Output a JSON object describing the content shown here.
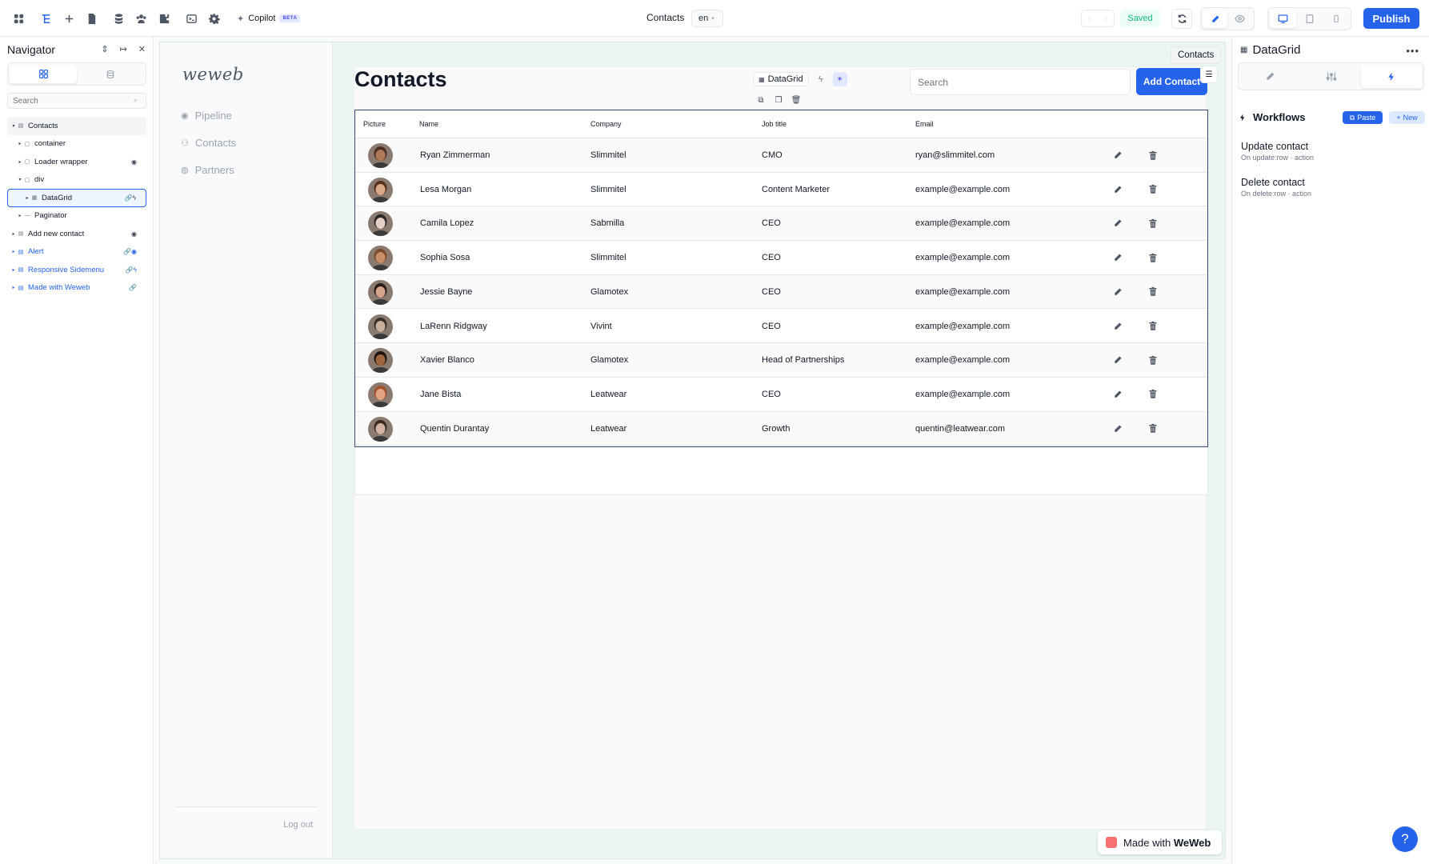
{
  "topbar": {
    "copilot_label": "Copilot",
    "beta_label": "BETA",
    "page_name": "Contacts",
    "language": "en",
    "saved_label": "Saved",
    "publish_label": "Publish"
  },
  "navigator": {
    "title": "Navigator",
    "search_placeholder": "Search",
    "items": [
      {
        "label": "Contacts",
        "depth": 0,
        "icon": "section",
        "badge": ""
      },
      {
        "label": "container",
        "depth": 1,
        "icon": "box",
        "badge": ""
      },
      {
        "label": "Loader wrapper",
        "depth": 1,
        "icon": "box",
        "badge": "hidden"
      },
      {
        "label": "div",
        "depth": 1,
        "icon": "box",
        "badge": ""
      },
      {
        "label": "DataGrid",
        "depth": 2,
        "icon": "grid",
        "badge": "link-bolt"
      },
      {
        "label": "Paginator",
        "depth": 1,
        "icon": "dash",
        "badge": ""
      },
      {
        "label": "Add new contact",
        "depth": 0,
        "icon": "section",
        "badge": "hidden"
      },
      {
        "label": "Alert",
        "depth": 0,
        "icon": "section",
        "badge": "link-hidden"
      },
      {
        "label": "Responsive Sidemenu",
        "depth": 0,
        "icon": "section",
        "badge": "link-bolt"
      },
      {
        "label": "Made with Weweb",
        "depth": 0,
        "icon": "section",
        "badge": "link"
      }
    ]
  },
  "app": {
    "logo": "weweb",
    "menu": [
      "Pipeline",
      "Contacts",
      "Partners"
    ],
    "logout": "Log out",
    "title": "Contacts",
    "datagrid_chip": "DataGrid",
    "search_placeholder": "Search",
    "add_contact": "Add Contact",
    "contacts_tag": "Contacts",
    "made_with": "Made with",
    "made_with_brand": "WeWeb",
    "help": "?"
  },
  "grid": {
    "columns": [
      "Picture",
      "Name",
      "Company",
      "Job title",
      "Email"
    ],
    "rows": [
      {
        "name": "Ryan Zimmerman",
        "company": "Slimmitel",
        "job": "CMO",
        "email": "ryan@slimmitel.com",
        "skin": "#b07a5a",
        "hair": "#4a3020"
      },
      {
        "name": "Lesa Morgan",
        "company": "Slimmitel",
        "job": "Content Marketer",
        "email": "example@example.com",
        "skin": "#d9a98a",
        "hair": "#5a2f20"
      },
      {
        "name": "Camila Lopez",
        "company": "Sabmilla",
        "job": "CEO",
        "email": "example@example.com",
        "skin": "#e6d0c4",
        "hair": "#2a2a2a"
      },
      {
        "name": "Sophia Sosa",
        "company": "Slimmitel",
        "job": "CEO",
        "email": "example@example.com",
        "skin": "#c98e6a",
        "hair": "#7a4a2a"
      },
      {
        "name": "Jessie Bayne",
        "company": "Glamotex",
        "job": "CEO",
        "email": "example@example.com",
        "skin": "#d6a48c",
        "hair": "#2a1a18"
      },
      {
        "name": "LaRenn Ridgway",
        "company": "Vivint",
        "job": "CEO",
        "email": "example@example.com",
        "skin": "#c9b09c",
        "hair": "#3a3028"
      },
      {
        "name": "Xavier Blanco",
        "company": "Glamotex",
        "job": "Head of Partnerships",
        "email": "example@example.com",
        "skin": "#a0663e",
        "hair": "#1e1410"
      },
      {
        "name": "Jane Bista",
        "company": "Leatwear",
        "job": "CEO",
        "email": "example@example.com",
        "skin": "#e0a482",
        "hair": "#a0502a"
      },
      {
        "name": "Quentin Durantay",
        "company": "Leatwear",
        "job": "Growth",
        "email": "quentin@leatwear.com",
        "skin": "#d2b4a4",
        "hair": "#3a2a22"
      }
    ]
  },
  "rightpanel": {
    "title": "DataGrid",
    "workflows_label": "Workflows",
    "paste_label": "Paste",
    "new_label": "New",
    "workflows": [
      {
        "name": "Update contact",
        "trigger": "On update:row · action"
      },
      {
        "name": "Delete contact",
        "trigger": "On delete:row · action"
      }
    ]
  },
  "colors": {
    "accent": "#2563eb",
    "saved": "#10b981",
    "canvas_bg": "#ebf5f1"
  }
}
